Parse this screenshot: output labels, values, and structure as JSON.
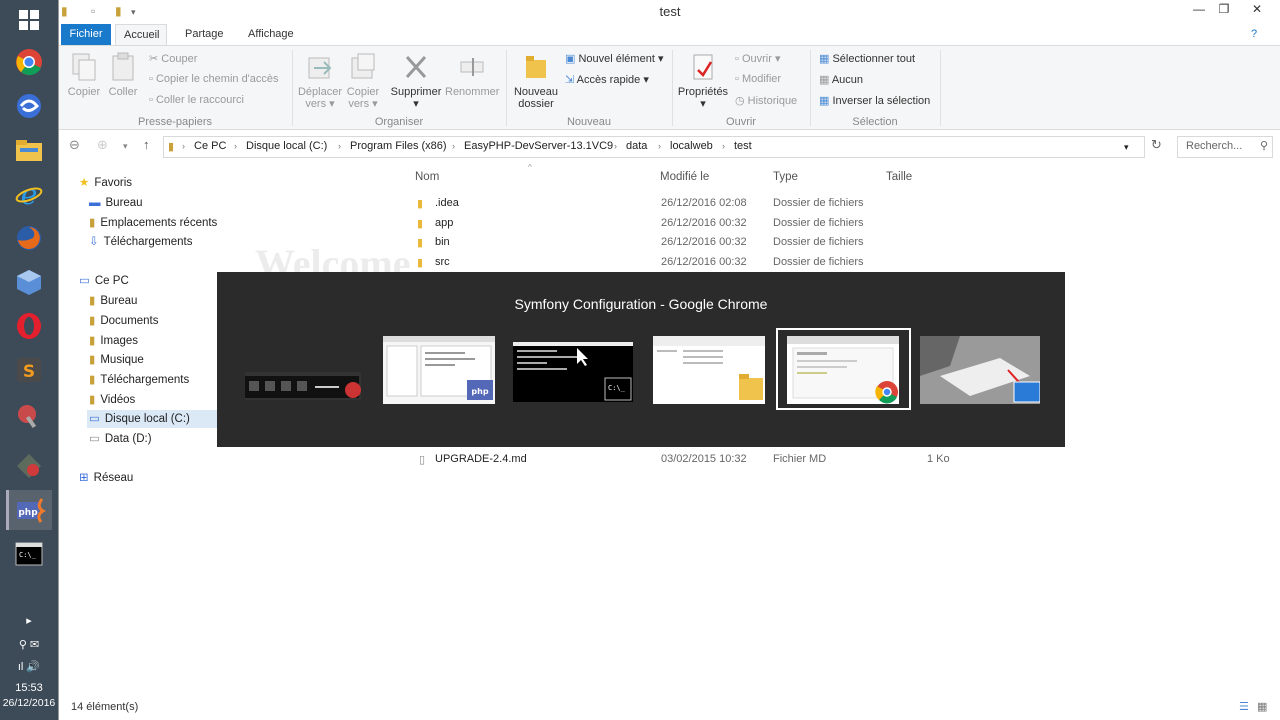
{
  "taskbar": {
    "time": "15:53",
    "date": "26/12/2016",
    "apps": [
      "Google Chrome",
      "Outil",
      "Explorateur",
      "Internet Explorer",
      "Firefox",
      "VirtualBox",
      "Opera",
      "Sublime Text",
      "Sous-système",
      "Outil réseau",
      "EasyPHP",
      "Invite de commandes"
    ]
  },
  "window": {
    "title": "test",
    "minimize": "—",
    "maximize": "❐",
    "close": "✕"
  },
  "ribbon": {
    "tabs": [
      "Fichier",
      "Accueil",
      "Partage",
      "Affichage"
    ],
    "copier": "Copier",
    "coller": "Coller",
    "couper": "Couper",
    "copier_chemin": "Copier le chemin d'accès",
    "coller_raccourci": "Coller le raccourci",
    "group_presse": "Presse-papiers",
    "deplacer_l1": "Déplacer",
    "deplacer_l2": "vers ▾",
    "copier_vers_l1": "Copier",
    "copier_vers_l2": "vers ▾",
    "supprimer": "Supprimer",
    "supprimer_arrow": "▾",
    "renommer": "Renommer",
    "group_organiser": "Organiser",
    "nouveau_dossier_l1": "Nouveau",
    "nouveau_dossier_l2": "dossier",
    "nouvel_element": "Nouvel élément ▾",
    "acces_rapide": "Accès rapide ▾",
    "group_nouveau": "Nouveau",
    "proprietes": "Propriétés",
    "proprietes_arrow": "▾",
    "ouvrir": "Ouvrir ▾",
    "modifier": "Modifier",
    "historique": "Historique",
    "group_ouvrir": "Ouvrir",
    "selectionner_tout": "Sélectionner tout",
    "aucun": "Aucun",
    "inverser": "Inverser la sélection",
    "group_selection": "Sélection"
  },
  "address": {
    "crumbs": [
      "Ce PC",
      "Disque local (C:)",
      "Program Files (x86)",
      "EasyPHP-DevServer-13.1VC9",
      "data",
      "localweb",
      "test"
    ],
    "search_placeholder": "Recherch..."
  },
  "nav": {
    "favoris": "Favoris",
    "favoris_items": [
      "Bureau",
      "Emplacements récents",
      "Téléchargements"
    ],
    "ce_pc": "Ce PC",
    "ce_pc_items": [
      "Bureau",
      "Documents",
      "Images",
      "Musique",
      "Téléchargements",
      "Vidéos",
      "Disque local (C:)",
      "Data (D:)"
    ],
    "reseau": "Réseau"
  },
  "files": {
    "columns": [
      "Nom",
      "Modifié le",
      "Type",
      "Taille"
    ],
    "rows": [
      {
        "name": ".idea",
        "date": "26/12/2016 02:08",
        "type": "Dossier de fichiers",
        "size": ""
      },
      {
        "name": "app",
        "date": "26/12/2016 00:32",
        "type": "Dossier de fichiers",
        "size": ""
      },
      {
        "name": "bin",
        "date": "26/12/2016 00:32",
        "type": "Dossier de fichiers",
        "size": ""
      },
      {
        "name": "src",
        "date": "26/12/2016 00:32",
        "type": "Dossier de fichiers",
        "size": ""
      },
      {
        "name": "UPGRADE-2.4.md",
        "date": "03/02/2015 10:32",
        "type": "Fichier MD",
        "size": "1 Ko"
      }
    ]
  },
  "status": {
    "count": "14 élément(s)"
  },
  "alttab": {
    "title": "Symfony Configuration - Google Chrome",
    "selected_index": 4
  }
}
